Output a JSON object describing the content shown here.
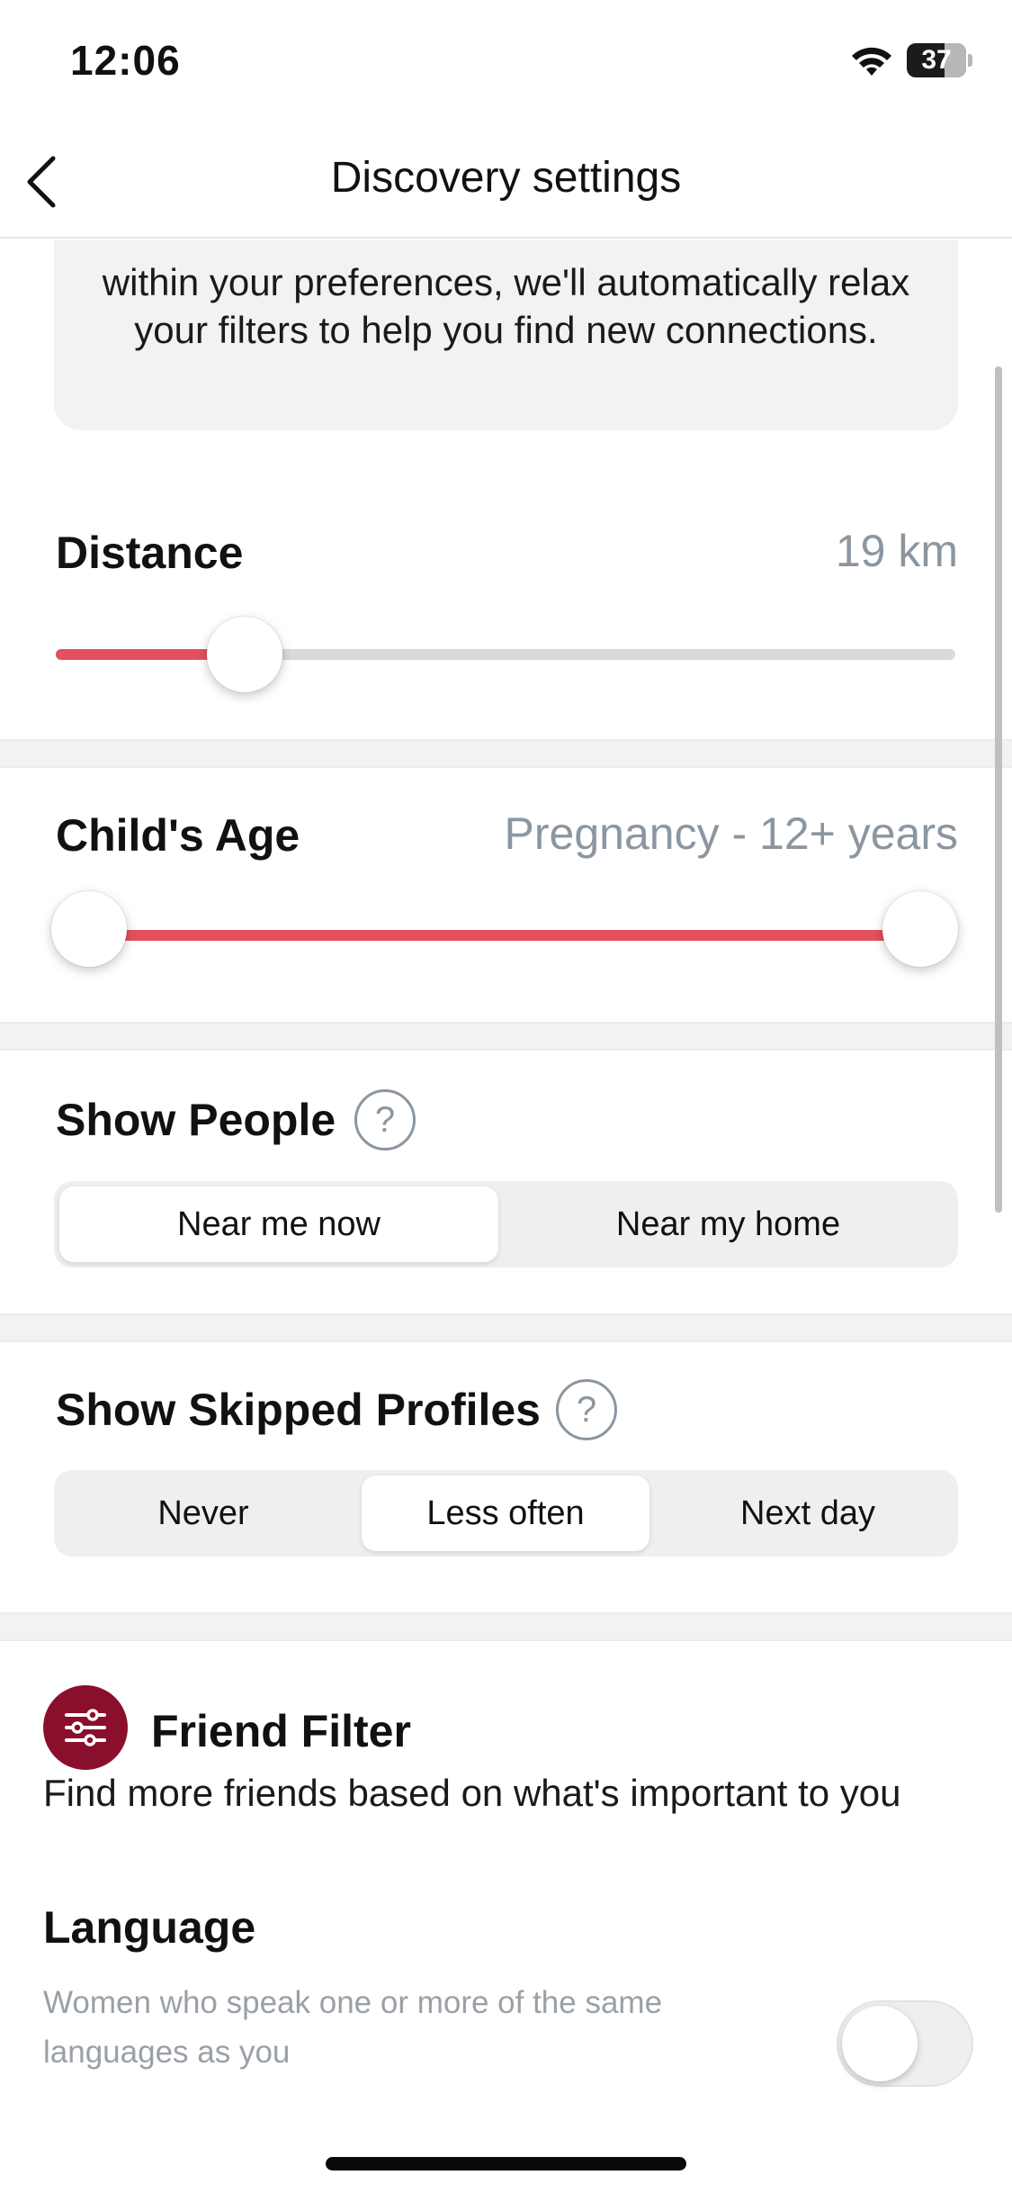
{
  "status_bar": {
    "time": "12:06",
    "battery_level": "37",
    "icons": [
      "wifi-icon",
      "battery-icon"
    ]
  },
  "nav": {
    "title": "Discovery settings",
    "back_icon": "chevron-left-icon"
  },
  "info_card": {
    "text": "within your preferences, we'll automatically relax your filters to help you find new connections."
  },
  "distance": {
    "title": "Distance",
    "value": "19 km",
    "slider_fraction": 0.21
  },
  "child_age": {
    "title": "Child's Age",
    "value": "Pregnancy - 12+ years",
    "range_fraction": [
      0.0,
      1.0
    ]
  },
  "show_people": {
    "title": "Show People",
    "help_symbol": "?",
    "options": [
      "Near me now",
      "Near my home"
    ],
    "selected": "Near me now"
  },
  "show_skipped": {
    "title": "Show Skipped Profiles",
    "help_symbol": "?",
    "options": [
      "Never",
      "Less often",
      "Next day"
    ],
    "selected": "Less often"
  },
  "friend_filter": {
    "title": "Friend Filter",
    "icon": "sliders-icon",
    "icon_color": "#8a0f2c",
    "description": "Find more friends based on what's important to you"
  },
  "language": {
    "title": "Language",
    "description": "Women who speak one or more of the same languages as you",
    "enabled": false
  },
  "colors": {
    "accent": "#e4505d",
    "muted_text": "#8b96a0",
    "background_band": "#f2f2f3"
  }
}
